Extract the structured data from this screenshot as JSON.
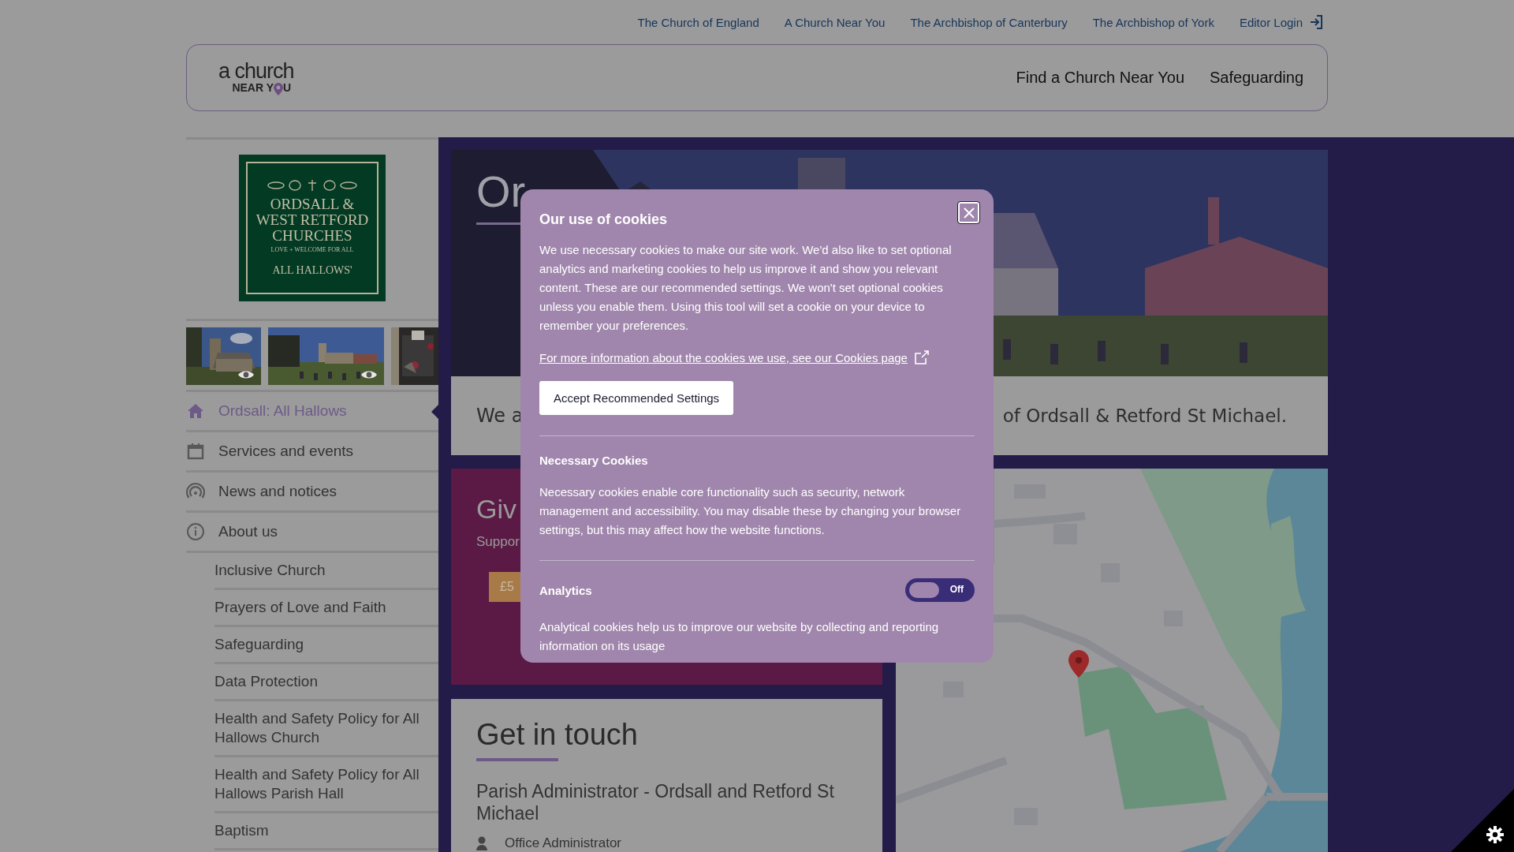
{
  "top_links": [
    {
      "label": "The Church of England",
      "kind": "link"
    },
    {
      "label": "A Church Near You",
      "kind": "link"
    },
    {
      "label": "The Archbishop of Canterbury",
      "kind": "link"
    },
    {
      "label": "The Archbishop of York",
      "kind": "link"
    },
    {
      "label": "Editor Login",
      "kind": "login"
    }
  ],
  "header": {
    "logo": {
      "top": "a church",
      "bottom_start": "NEAR Y",
      "bottom_end": "U"
    },
    "nav": [
      {
        "label": "Find a Church Near You"
      },
      {
        "label": "Safeguarding"
      }
    ]
  },
  "sidebar": {
    "church_logo": {
      "name": "ORDSALL & WEST RETFORD CHURCHES",
      "motto": "LOVE + WELCOME FOR ALL",
      "church": "ALL HALLOWS'"
    },
    "nav": [
      {
        "label": "Ordsall: All Hallows",
        "kind": "home",
        "selected": true
      },
      {
        "label": "Services and events",
        "kind": "calendar",
        "selected": false
      },
      {
        "label": "News and notices",
        "kind": "news",
        "selected": false
      },
      {
        "label": "About us",
        "kind": "info",
        "selected": false,
        "children": [
          {
            "label": "Inclusive Church",
            "selected": false
          },
          {
            "label": "Prayers of Love and Faith",
            "selected": false
          },
          {
            "label": "Safeguarding",
            "selected": false
          },
          {
            "label": "Data Protection",
            "selected": false
          },
          {
            "label": "Health and Safety Policy for All Hallows Church",
            "selected": false
          },
          {
            "label": "Health and Safety Policy for All Hallows Parish Hall",
            "selected": false
          },
          {
            "label": "Baptism",
            "selected": false
          }
        ]
      }
    ]
  },
  "hero": {
    "title": "Or"
  },
  "intro": {
    "text_start": "We a",
    "text_end": "of Ordsall & Retford St Michael."
  },
  "give": {
    "title": "Giv",
    "text": "Suppor",
    "amounts": [
      "£5"
    ]
  },
  "contact": {
    "title": "Get in touch",
    "role": "Parish Administrator - Ordsall and Retford St Michael",
    "person": "Office Administrator"
  },
  "cookie_dialog": {
    "title": "Our use of cookies",
    "intro": "We use necessary cookies to make our site work. We'd also like to set optional analytics and marketing cookies to help us improve it and show you relevant content. These are our recommended settings. We won't set optional cookies unless you enable them. Using this tool will set a cookie on your device to remember your preferences.",
    "more_link": "For more information about the cookies we use, see our Cookies page",
    "accept_button": "Accept Recommended Settings",
    "sections": [
      {
        "title": "Necessary Cookies",
        "text": "Necessary cookies enable core functionality such as security, network management and accessibility. You may disable these by changing your browser settings, but this may affect how the website functions."
      },
      {
        "title": "Analytics",
        "text": "Analytical cookies help us to improve our website by collecting and reporting information on its usage",
        "toggle": {
          "on": false,
          "label": "Off"
        }
      }
    ]
  }
}
